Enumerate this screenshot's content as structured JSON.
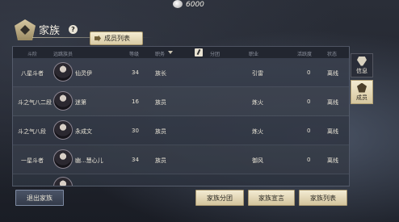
{
  "currency": {
    "amount": "6000"
  },
  "header": {
    "title": "家族",
    "help": "?"
  },
  "tab": {
    "label": "成员列表"
  },
  "table": {
    "headers": [
      "斗阶",
      "远跳族员",
      "等级",
      "职务",
      "分团",
      "职业",
      "活跃度",
      "状态"
    ],
    "rows": [
      {
        "rank": "八星斗者",
        "name": "仙灵伊",
        "level": "34",
        "position": "族长",
        "group": "",
        "profession": "引雷",
        "activity": "0",
        "status": "离线"
      },
      {
        "rank": "斗之气八二段",
        "name": "迷第",
        "level": "16",
        "position": "族员",
        "group": "",
        "profession": "炼火",
        "activity": "0",
        "status": "离线"
      },
      {
        "rank": "斗之气八段",
        "name": "永成文",
        "level": "30",
        "position": "族员",
        "group": "",
        "profession": "炼火",
        "activity": "0",
        "status": "离线"
      },
      {
        "rank": "一星斗者",
        "name": "幽...慧心儿",
        "level": "34",
        "position": "族员",
        "group": "",
        "profession": "御风",
        "activity": "0",
        "status": "离线"
      }
    ]
  },
  "side_tabs": [
    {
      "label": "信息",
      "icon": "info-emblem-icon"
    },
    {
      "label": "成员",
      "icon": "members-emblem-icon"
    }
  ],
  "buttons": {
    "leave": "退出家族",
    "group": "家族分团",
    "announce": "家族宣言",
    "list": "家族列表"
  }
}
